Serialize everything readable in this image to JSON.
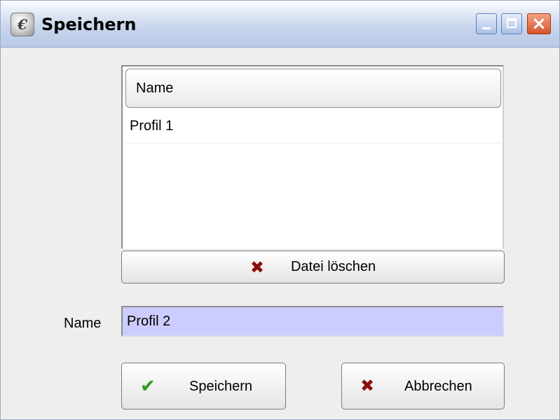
{
  "window": {
    "title": "Speichern",
    "icon_glyph": "€",
    "close_glyph": "×"
  },
  "table": {
    "column_header": "Name",
    "rows": [
      "Profil 1"
    ]
  },
  "buttons": {
    "delete_label": "Datei löschen",
    "save_label": "Speichern",
    "cancel_label": "Abbrechen",
    "x_glyph": "✖",
    "check_glyph": "✔"
  },
  "form": {
    "name_label": "Name",
    "name_value": "Profil 2"
  },
  "colors": {
    "input_background": "#ccccff",
    "titlebar": "#c6d4ec",
    "close_button": "#d6532b",
    "delete_icon": "#8b0e0e",
    "check_icon": "#2f9a1a"
  },
  "icons": {
    "app": "app-logo-icon",
    "minimize": "minimize-icon",
    "maximize": "maximize-icon",
    "close": "close-icon",
    "delete": "delete-x-icon",
    "save": "checkmark-icon",
    "cancel": "cancel-x-icon"
  }
}
